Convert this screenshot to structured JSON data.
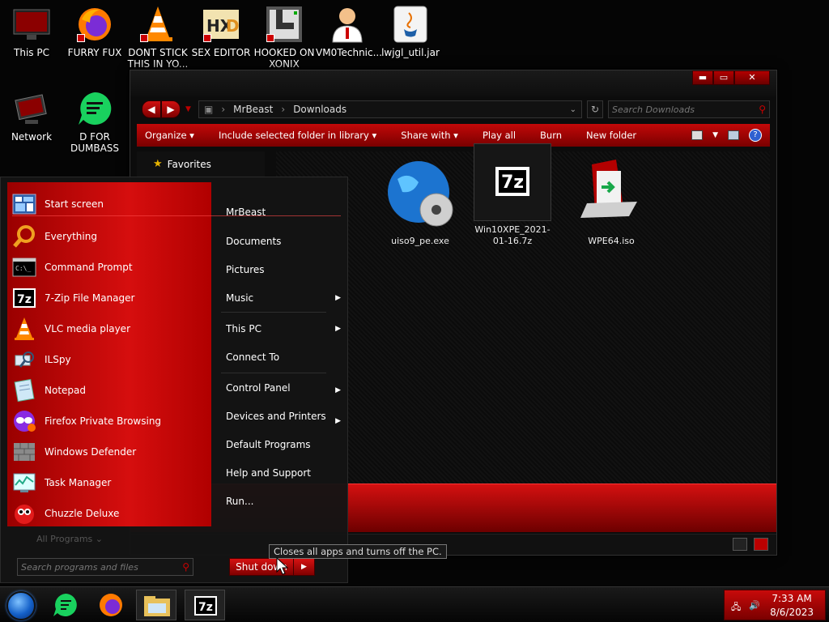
{
  "desktop": {
    "icons": [
      {
        "label": "This PC",
        "icon": "monitor-icon"
      },
      {
        "label": "FURRY FUX",
        "icon": "firefox-icon"
      },
      {
        "label": "DONT STICK THIS IN YO...",
        "icon": "vlc-cone-icon"
      },
      {
        "label": "SEX EDITOR",
        "icon": "hxd-editor-icon"
      },
      {
        "label": "HOOKED ON XONIX",
        "icon": "xonix-game-icon"
      },
      {
        "label": "VM0Technic...",
        "icon": "doctor-avatar-icon"
      },
      {
        "label": "lwjgl_util.jar",
        "icon": "java-icon"
      },
      {
        "label": "Network",
        "icon": "network-icon"
      },
      {
        "label": "D FOR DUMBASS",
        "icon": "chat-bubble-icon"
      }
    ]
  },
  "explorer": {
    "address": {
      "root_icon": "computer-icon",
      "crumbs": [
        "MrBeast",
        "Downloads"
      ]
    },
    "search_placeholder": "Search Downloads",
    "command_bar": [
      "Organize ▾",
      "Include selected folder in library ▾",
      "Share with ▾",
      "Play all",
      "Burn",
      "New folder"
    ],
    "nav_pane": {
      "favorites": "Favorites"
    },
    "files": [
      {
        "name": "uiso9_pe.exe",
        "icon": "globe-disc-icon"
      },
      {
        "name": "Win10XPE_2021-01-16.7z",
        "icon": "7zip-icon"
      },
      {
        "name": "WPE64.iso",
        "icon": "iso-file-icon"
      }
    ]
  },
  "start_menu": {
    "programs": [
      {
        "label": "Start screen",
        "icon": "start-screen-icon",
        "submenu": false
      },
      {
        "label": "Everything",
        "icon": "magnifier-icon",
        "submenu": false
      },
      {
        "label": "Command Prompt",
        "icon": "cmd-icon",
        "submenu": false
      },
      {
        "label": "7-Zip File Manager",
        "icon": "7zip-icon",
        "submenu": true
      },
      {
        "label": "VLC media player",
        "icon": "vlc-cone-icon",
        "submenu": true
      },
      {
        "label": "ILSpy",
        "icon": "ilspy-icon",
        "submenu": false
      },
      {
        "label": "Notepad",
        "icon": "notepad-icon",
        "submenu": true
      },
      {
        "label": "Firefox Private Browsing",
        "icon": "firefox-private-icon",
        "submenu": true
      },
      {
        "label": "Windows Defender",
        "icon": "defender-wall-icon",
        "submenu": false
      },
      {
        "label": "Task Manager",
        "icon": "task-manager-icon",
        "submenu": false
      },
      {
        "label": "Chuzzle Deluxe",
        "icon": "chuzzle-icon",
        "submenu": false
      }
    ],
    "all_programs": "All Programs",
    "search_placeholder": "Search programs and files",
    "places": [
      "MrBeast",
      "Documents",
      "Pictures",
      "Music",
      "This PC",
      "Connect To",
      "Control Panel",
      "Devices and Printers",
      "Default Programs",
      "Help and Support",
      "Run..."
    ],
    "shutdown_label": "Shut down",
    "tooltip": "Closes all apps and turns off the PC."
  },
  "taskbar": {
    "apps": [
      {
        "icon": "chat-bubble-icon"
      },
      {
        "icon": "firefox-icon"
      },
      {
        "icon": "file-explorer-icon"
      },
      {
        "icon": "7zip-icon"
      }
    ],
    "time": "7:33 AM",
    "date": "8/6/2023"
  },
  "colors": {
    "accent": "#c40c0c",
    "accent_dark": "#6d0000",
    "window_bg": "#0c0c0c"
  }
}
